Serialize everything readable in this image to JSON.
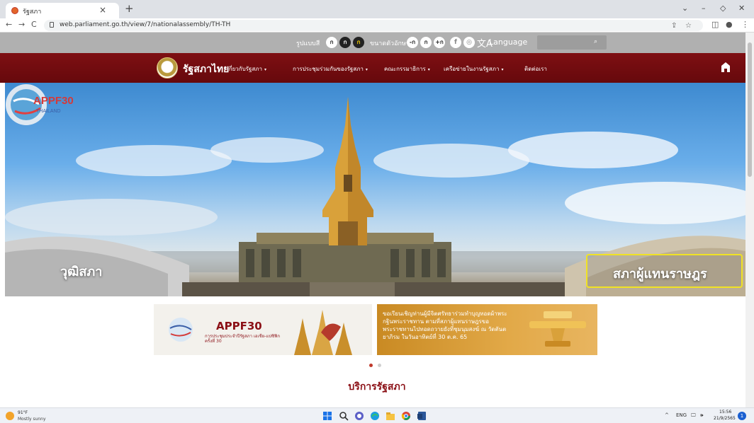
{
  "browser": {
    "tab_title": "รัฐสภา",
    "tab_close": "×",
    "new_tab": "+",
    "url": "web.parliament.go.th/view/7/nationalassembly/TH-TH",
    "back": "←",
    "forward": "→",
    "reload": "C",
    "share": "⇪",
    "star": "☆",
    "sidepanel": "◫",
    "profile": "●",
    "menu": "⋮",
    "minimize": "–",
    "maximize": "◇",
    "close": "✕",
    "dropdown": "⌄"
  },
  "accessibility": {
    "theme_label": "รูปแบบสี",
    "theme_buttons": [
      "ก",
      "ก",
      "ก"
    ],
    "font_label": "ขนาดตัวอักษร",
    "font_buttons": [
      "-ก",
      "ก",
      "+ก"
    ],
    "social": [
      "f",
      "◎"
    ],
    "language_icon": "文A",
    "language": "Language",
    "search_icon": "⌕"
  },
  "nav": {
    "site_title": "รัฐสภาไทย",
    "caret": "▾",
    "items": [
      {
        "label": "เกี่ยวกับรัฐสภา",
        "dropdown": true
      },
      {
        "label": "การประชุมร่วมกันของรัฐสภา",
        "dropdown": true
      },
      {
        "label": "คณะกรรมาธิการ",
        "dropdown": true
      },
      {
        "label": "เครือข่ายในงานรัฐสภา",
        "dropdown": true
      },
      {
        "label": "ติดต่อเรา",
        "dropdown": false
      }
    ]
  },
  "hero": {
    "left_label": "วุฒิสภา",
    "right_label": "สภาผู้แทนราษฎร",
    "badge_title": "APPF30",
    "badge_sub": "THAILAND"
  },
  "banners": {
    "banner1_title": "APPF30",
    "banner1_sub": "การประชุมประจำปีรัฐสภา เอเชีย-แปซิฟิก ครั้งที่ 30",
    "banner2_text": "ขอเรียนเชิญท่านผู้มีจิตศรัทธาร่วมทำบุญทอดผ้าพระกฐินพระราชทาน ตามที่สภาผู้แทนราษฎรขอพระราชทานไปทอดถวายยังที่ชุมนุมสงฆ์ ณ วัดตันตยาภิรม ในวันอาทิตย์ที่ 30 ต.ค. 65"
  },
  "carousel": {
    "total": 2,
    "active": 0
  },
  "section": {
    "title": "บริการรัฐสภา"
  },
  "taskbar": {
    "weather_temp": "91°F",
    "weather_desc": "Mostly sunny",
    "tray_caret": "^",
    "tray_lang": "ENG",
    "tray_display": "🖵",
    "tray_sound": "🕪",
    "time": "15:56",
    "date": "21/9/2565",
    "notification_count": "1"
  },
  "colors": {
    "maroon": "#7e0f13",
    "accent_yellow": "#f0e224",
    "accbar_grey": "#b0b0b0",
    "dot_active": "#c0392b",
    "dot_inactive": "#cfcfcf"
  }
}
